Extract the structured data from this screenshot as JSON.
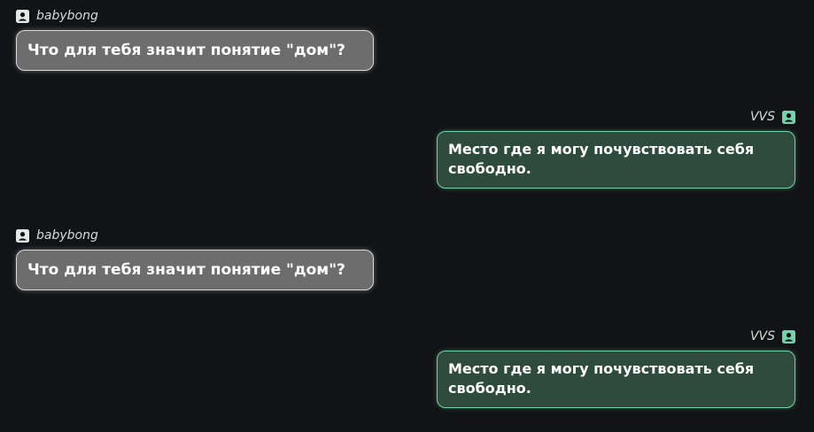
{
  "colors": {
    "background": "#121316",
    "left_bubble": "#6d6d6d",
    "left_border": "#d8d8d8",
    "right_bubble": "#2f4b3d",
    "right_border": "#74d2a9",
    "right_icon": "#74d2a9"
  },
  "messages": [
    {
      "side": "left",
      "author": "babybong",
      "icon": "user-icon",
      "text": "Что для тебя значит понятие \"дом\"?"
    },
    {
      "side": "right",
      "author": "VVS",
      "icon": "user-icon",
      "text": "Место где я могу почувствовать себя свободно."
    },
    {
      "side": "left",
      "author": "babybong",
      "icon": "user-icon",
      "text": "Что для тебя значит понятие \"дом\"?"
    },
    {
      "side": "right",
      "author": "VVS",
      "icon": "user-icon",
      "text": "Место где я могу почувствовать себя свободно."
    }
  ]
}
